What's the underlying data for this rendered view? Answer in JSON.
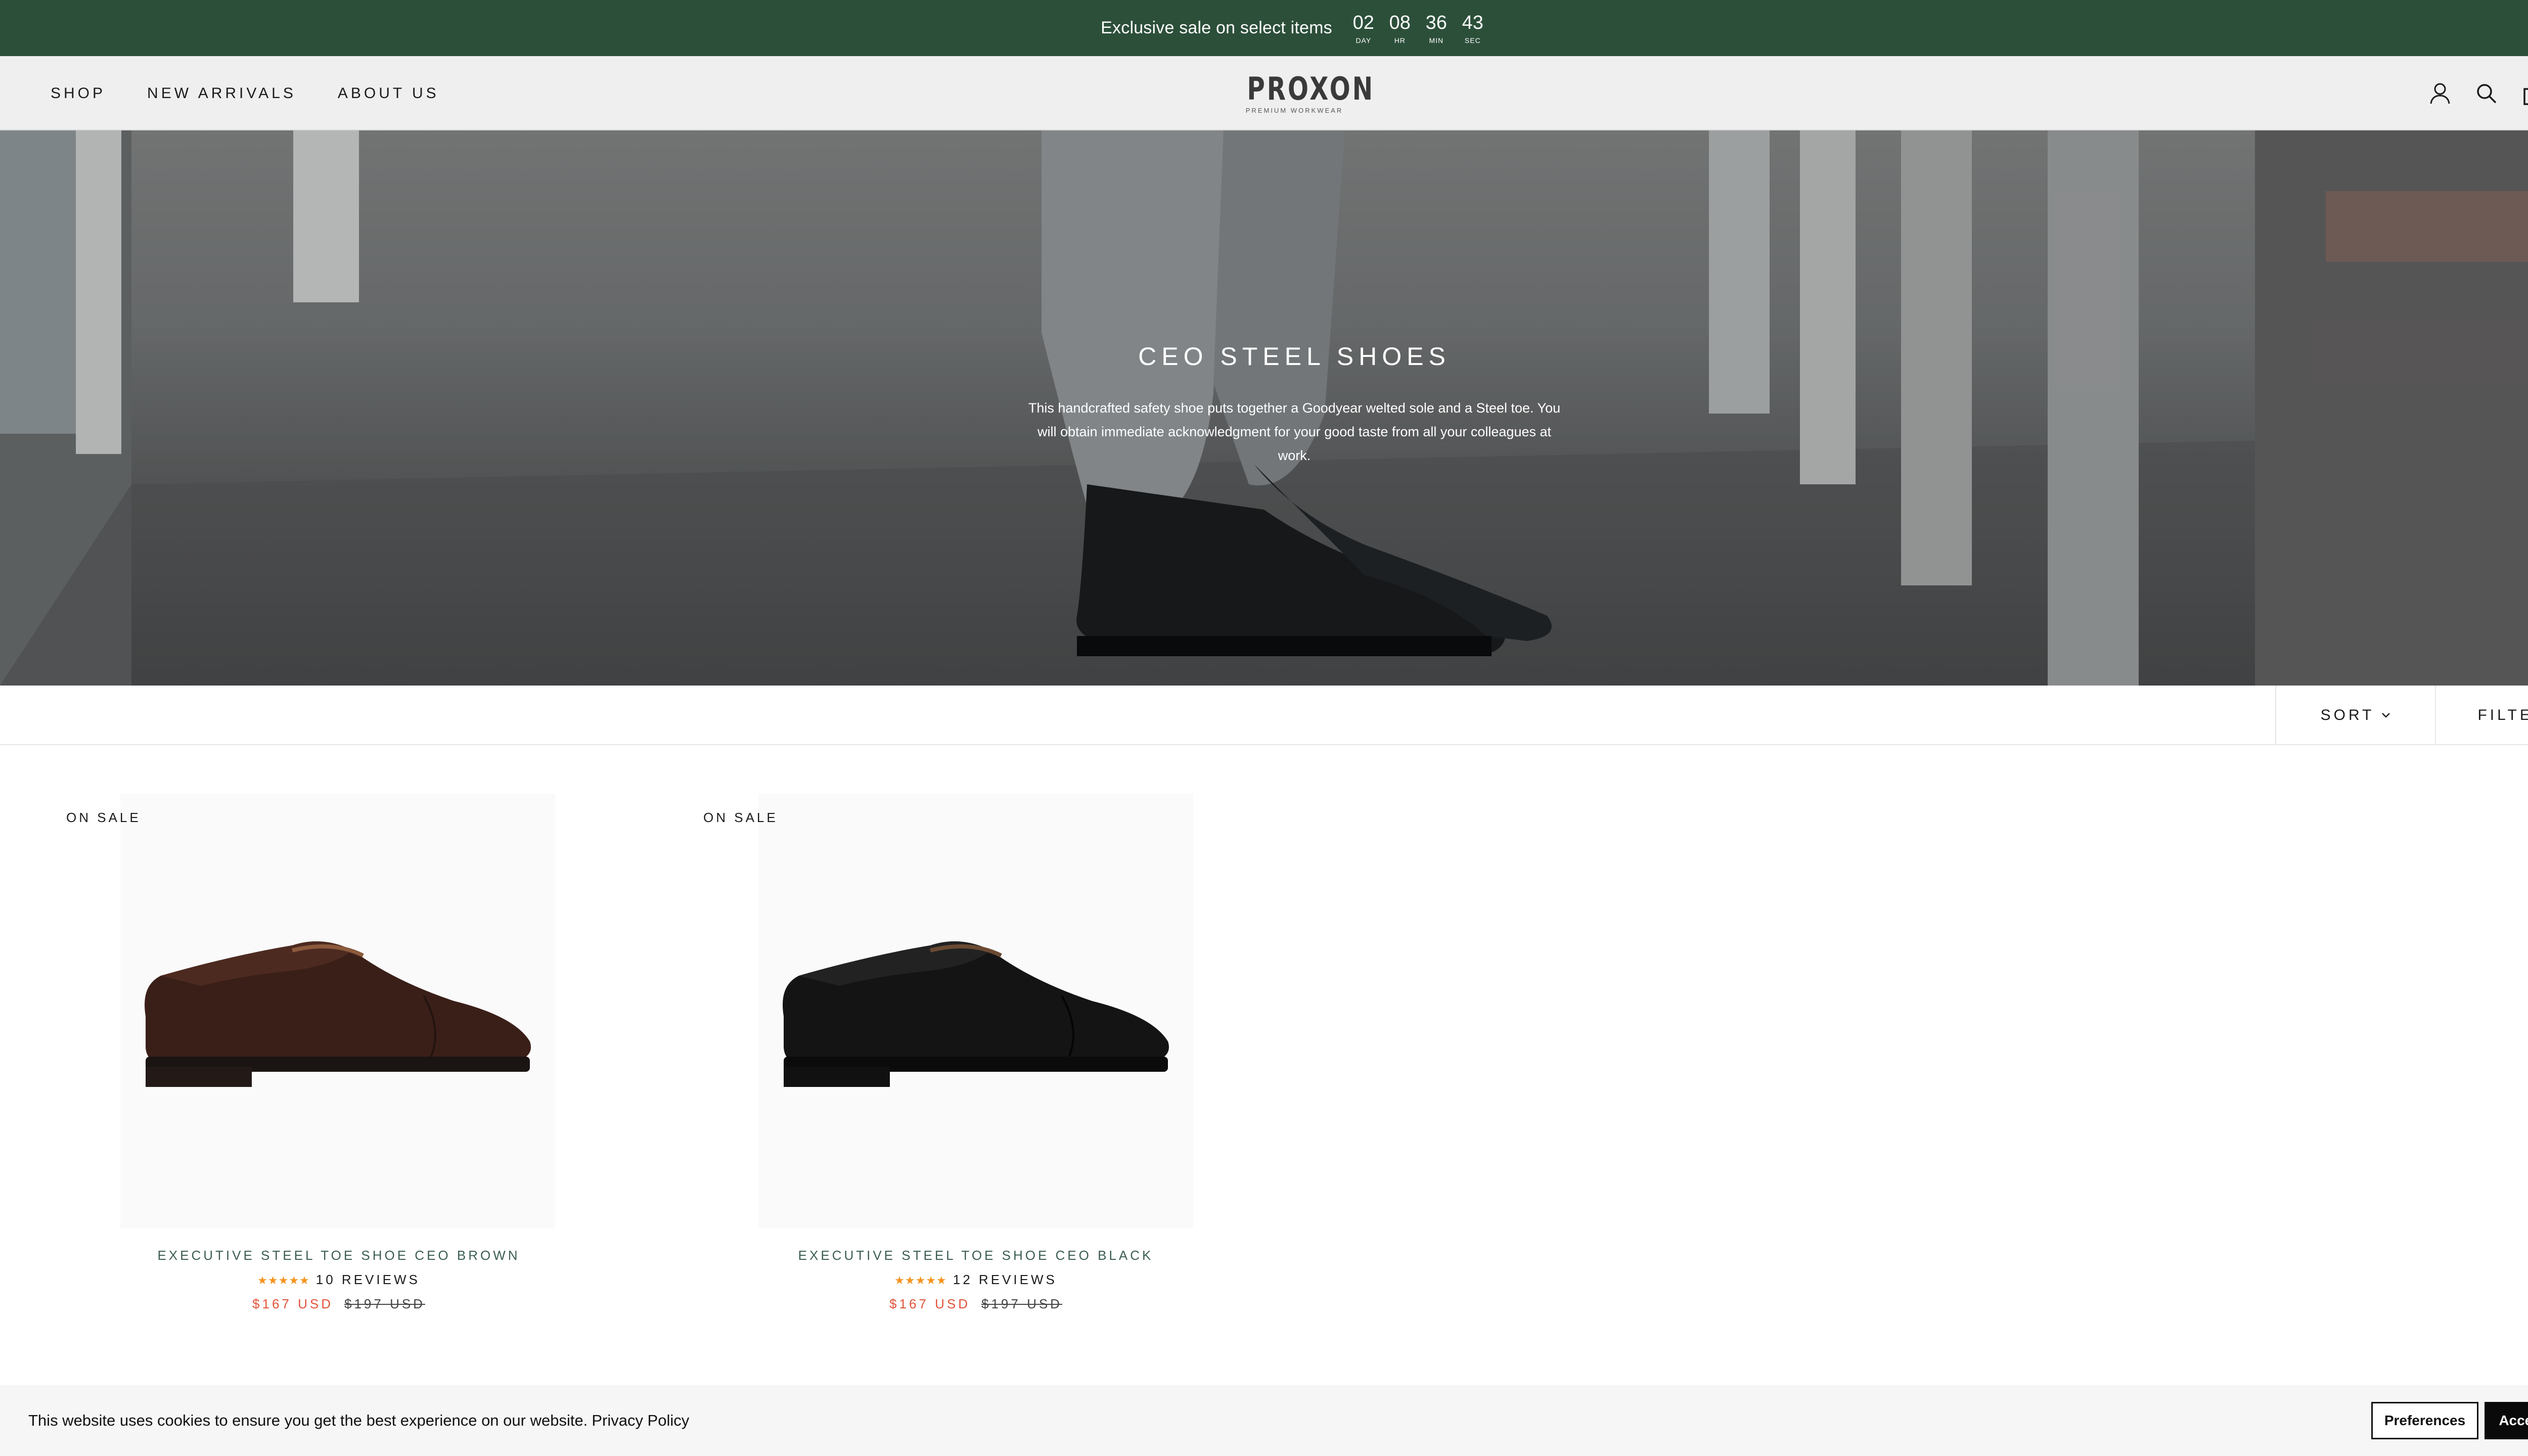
{
  "announcement": {
    "message": "Exclusive sale on select items",
    "countdown": [
      {
        "value": "02",
        "label": "DAY"
      },
      {
        "value": "08",
        "label": "HR"
      },
      {
        "value": "36",
        "label": "MIN"
      },
      {
        "value": "43",
        "label": "SEC"
      }
    ],
    "background_color": "#2c4f3a"
  },
  "header": {
    "nav": [
      "SHOP",
      "NEW ARRIVALS",
      "ABOUT US"
    ],
    "logo": {
      "name": "PROXON",
      "tagline": "PREMIUM WORKWEAR"
    },
    "icons": [
      "account-icon",
      "search-icon",
      "cart-icon"
    ]
  },
  "hero": {
    "title": "CEO STEEL SHOES",
    "description": "This handcrafted safety shoe puts together a Goodyear welted sole and a Steel toe. You will obtain immediate acknowledgment for your good taste from all your colleagues at work."
  },
  "toolbar": {
    "sort_label": "SORT",
    "filter_label": "FILTER"
  },
  "products": [
    {
      "badge": "ON SALE",
      "name": "EXECUTIVE STEEL TOE SHOE CEO BROWN",
      "stars": "★★★★★",
      "rating": 5,
      "reviews": "10 REVIEWS",
      "price": "$167 USD",
      "compare_price": "$197 USD",
      "color": "brown"
    },
    {
      "badge": "ON SALE",
      "name": "EXECUTIVE STEEL TOE SHOE CEO BLACK",
      "stars": "★★★★★",
      "rating": 4.5,
      "reviews": "12 REVIEWS",
      "price": "$167 USD",
      "compare_price": "$197 USD",
      "color": "black"
    }
  ],
  "cookie": {
    "text": "This website uses cookies to ensure you get the best experience on our website.",
    "link": "Privacy Policy",
    "preferences_label": "Preferences",
    "accept_label": "Accept"
  },
  "colors": {
    "accent_green": "#2c4f3a",
    "sale_red": "#e2543a",
    "star_orange": "#f7931e",
    "product_title": "#3b5d53"
  }
}
